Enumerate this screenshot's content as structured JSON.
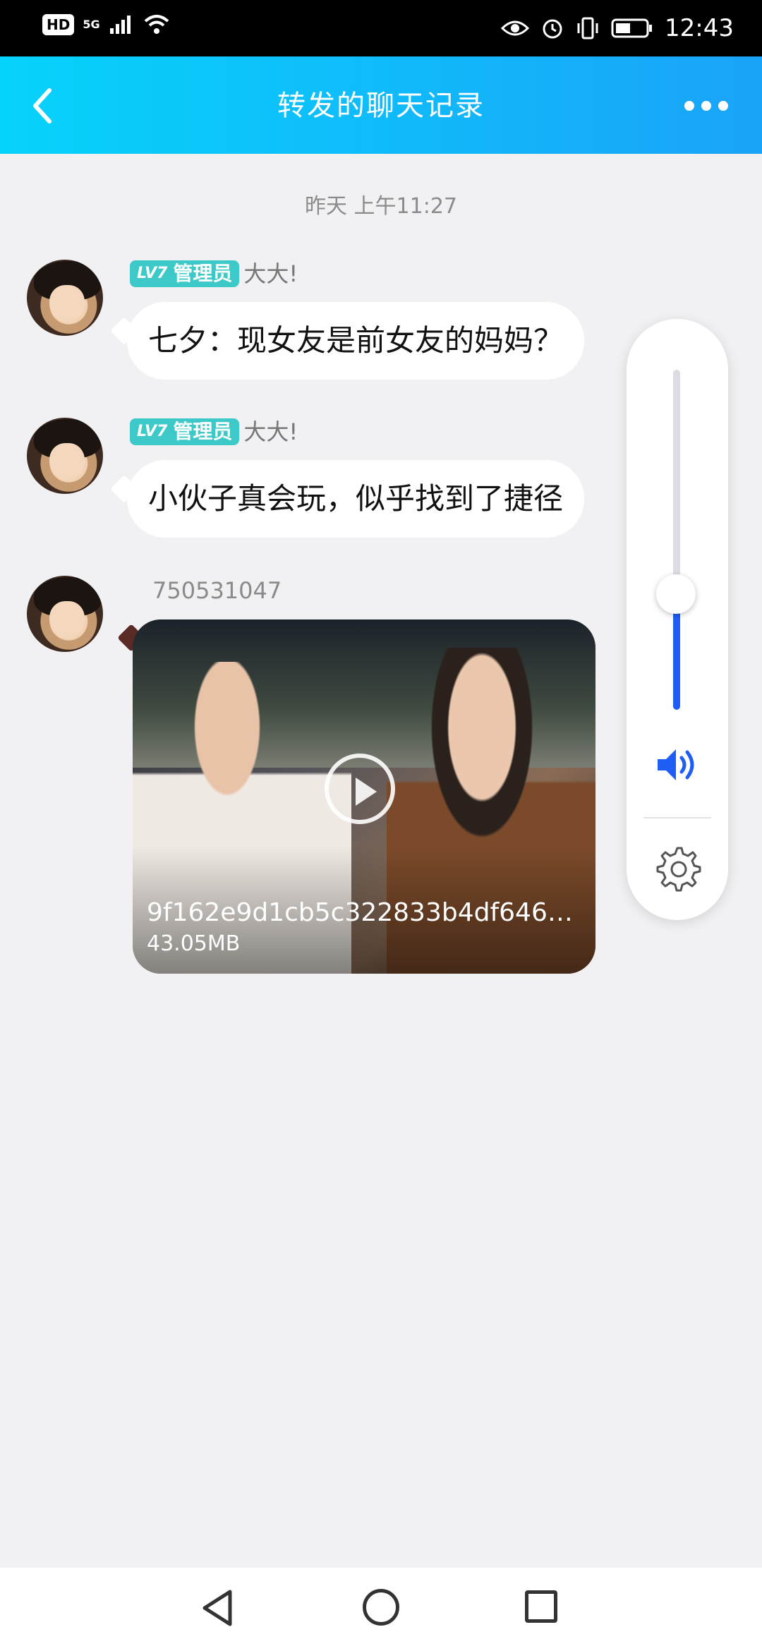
{
  "status_bar": {
    "hd": "HD",
    "network": "5G",
    "time": "12:43",
    "icons": [
      "signal-icon",
      "wifi-icon",
      "eye-icon",
      "alarm-icon",
      "vibrate-icon",
      "battery-icon"
    ]
  },
  "header": {
    "title": "转发的聊天记录",
    "back_icon": "back-chevron-icon",
    "more_icon": "more-dots-icon"
  },
  "chat": {
    "timestamp": "昨天 上午11:27",
    "messages": [
      {
        "badge_level": "LV7",
        "badge_role": "管理员",
        "sender": "大大!",
        "text": "七夕：现女友是前女友的妈妈？"
      },
      {
        "badge_level": "LV7",
        "badge_role": "管理员",
        "sender": "大大!",
        "text": "小伙子真会玩，似乎找到了捷径"
      },
      {
        "sender": "750531047",
        "video": {
          "filename": "9f162e9d1cb5c322833b4df646a9…",
          "size": "43.05MB"
        }
      }
    ]
  },
  "volume_panel": {
    "level": 0.34,
    "speaker_icon": "speaker-icon",
    "settings_icon": "gear-icon",
    "accent_color": "#1f5ef5"
  },
  "nav_bar": {
    "icons": [
      "nav-back-icon",
      "nav-home-icon",
      "nav-recent-icon"
    ]
  },
  "colors": {
    "header_gradient_start": "#06d3fb",
    "header_gradient_end": "#1aa3f8",
    "badge": "#3cc9c7",
    "background": "#f1f1f3"
  }
}
